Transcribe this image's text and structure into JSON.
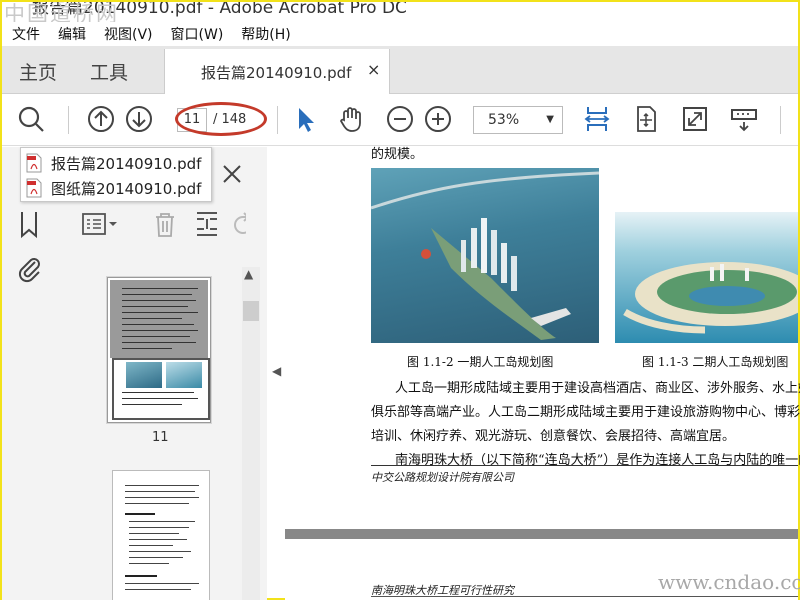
{
  "window": {
    "title": "报告篇20140910.pdf - Adobe Acrobat Pro DC",
    "watermark_top": "中国道桥网",
    "watermark_bottom": "www.cndao.com"
  },
  "menu": [
    "文件",
    "编辑",
    "视图(V)",
    "窗口(W)",
    "帮助(H)"
  ],
  "tabs": {
    "home": "主页",
    "tools": "工具",
    "document": "报告篇20140910.pdf",
    "close": "×"
  },
  "toolbar": {
    "current_page": "11",
    "total_pages": "/ 148",
    "zoom": "53%",
    "accent": "#2a6ebb"
  },
  "recent_files": [
    "报告篇20140910.pdf",
    "图纸篇20140910.pdf"
  ],
  "thumbnails": {
    "page_label": "11"
  },
  "document": {
    "top_fragment": "的规模。",
    "caption1": "图 1.1-2    一期人工岛规划图",
    "caption2": "图 1.1-3    二期人工岛规划图",
    "para1_line1": "人工岛一期形成陆域主要用于建设高档酒店、商业区、涉外服务、水上娱乐和",
    "para1_line2": "俱乐部等高端产业。人工岛二期形成陆域主要用于建设旅游购物中心、博彩娱乐、",
    "para1_line3": "培训、休闲疗养、观光游玩、创意餐饮、会展招待、高端宜居。",
    "para2_line1": "南海明珠大桥（以下简称“连岛大桥”）是作为连接人工岛与内陆的唯一的陆路",
    "footer_org": "中交公路规划设计院有限公司",
    "next_page_header": "南海明珠大桥工程可行性研究"
  }
}
